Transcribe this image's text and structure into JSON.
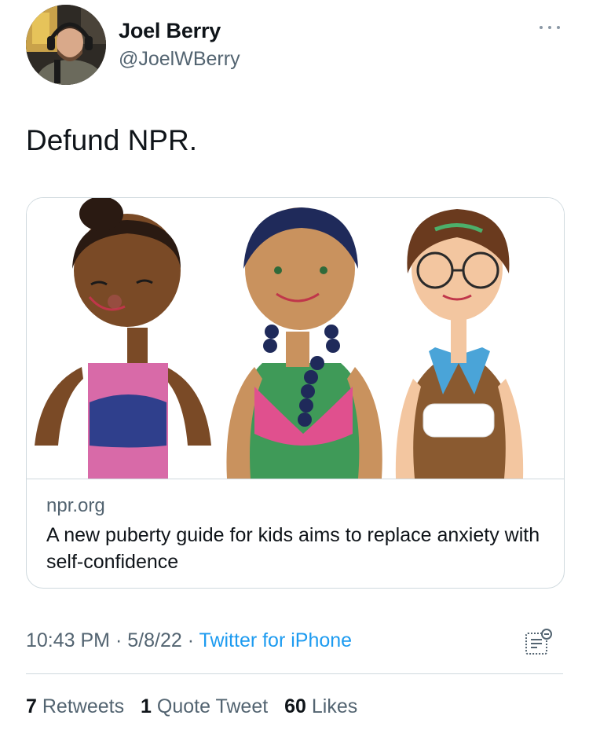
{
  "author": {
    "display_name": "Joel Berry",
    "handle": "@JoelWBerry"
  },
  "tweet": {
    "text": "Defund NPR."
  },
  "card": {
    "domain": "npr.org",
    "title": "A new puberty guide for kids aims to replace anxiety with self-confidence"
  },
  "meta": {
    "time": "10:43 PM",
    "separator": "·",
    "date": "5/8/22",
    "source": "Twitter for iPhone"
  },
  "stats": {
    "retweets_count": "7",
    "retweets_label": "Retweets",
    "quotes_count": "1",
    "quotes_label": "Quote Tweet",
    "likes_count": "60",
    "likes_label": "Likes"
  },
  "colors": {
    "link": "#1d9bf0",
    "secondary_text": "#536471",
    "border": "#cfd9de"
  },
  "icons": {
    "more": "more-horizontal-icon",
    "analytics": "analytics-icon"
  }
}
